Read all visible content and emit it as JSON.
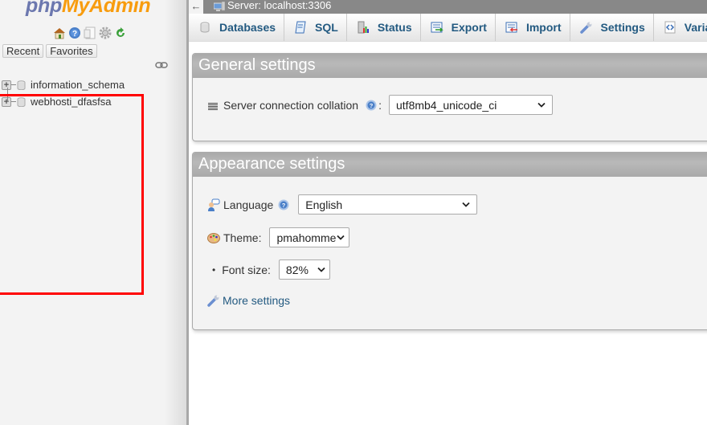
{
  "sidebar": {
    "logo": {
      "part1": "php",
      "part2": "MyAdmin"
    },
    "nav_icons": [
      "home-icon",
      "help-icon",
      "docs-icon",
      "settings-icon",
      "reload-icon"
    ],
    "tabs": [
      {
        "label": "Recent"
      },
      {
        "label": "Favorites"
      }
    ],
    "databases": [
      {
        "name": "information_schema"
      },
      {
        "name": "webhosti_dfasfsa"
      }
    ]
  },
  "serverbar": {
    "back": "←",
    "title": "Server: localhost:3306"
  },
  "menu": [
    {
      "label": "Databases",
      "icon": "database-icon"
    },
    {
      "label": "SQL",
      "icon": "sql-icon"
    },
    {
      "label": "Status",
      "icon": "status-icon"
    },
    {
      "label": "Export",
      "icon": "export-icon"
    },
    {
      "label": "Import",
      "icon": "import-icon"
    },
    {
      "label": "Settings",
      "icon": "settings-wrench-icon"
    },
    {
      "label": "Variables",
      "icon": "variables-icon"
    }
  ],
  "general": {
    "title": "General settings",
    "collation_label": "Server connection collation",
    "collation_suffix": ":",
    "collation_value": "utf8mb4_unicode_ci"
  },
  "appearance": {
    "title": "Appearance settings",
    "language_label": "Language",
    "language_value": "English",
    "theme_label": "Theme:",
    "theme_value": "pmahomme",
    "fontsize_bullet": "•",
    "fontsize_label": "Font size:",
    "fontsize_value": "82%",
    "more_settings": "More settings"
  },
  "annotation": {
    "color": "#ff0000"
  }
}
